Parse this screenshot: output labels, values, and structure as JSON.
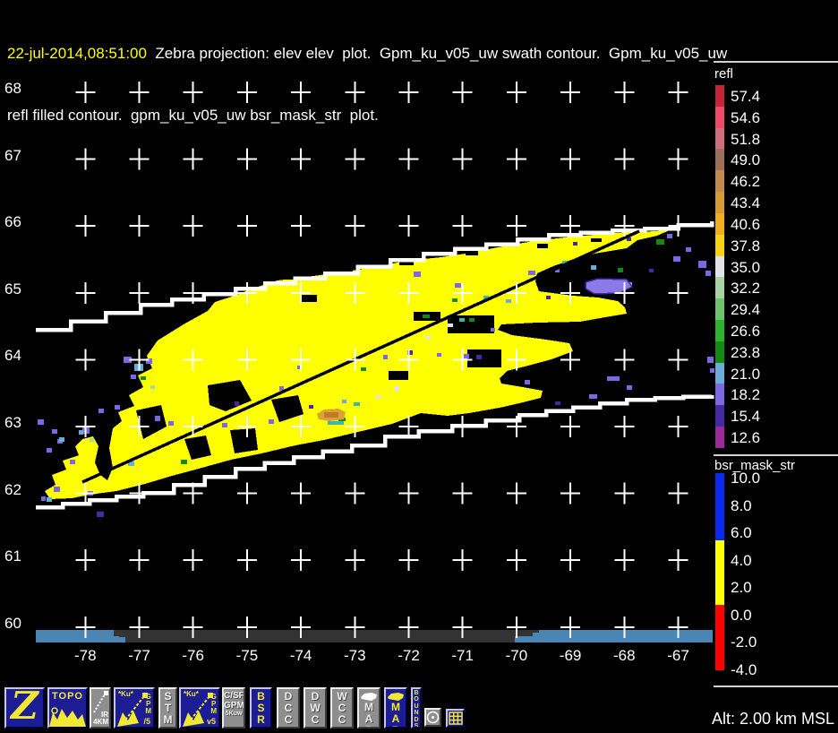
{
  "header": {
    "timestamp": "22-jul-2014,08:51:00",
    "title_line1": "Zebra projection: elev elev  plot.  Gpm_ku_v05_uw swath contour.  Gpm_ku_v05_uw",
    "title_line2": "refl filled contour.  gpm_ku_v05_uw bsr_mask_str  plot."
  },
  "map": {
    "lat_labels": [
      "68",
      "67",
      "66",
      "65",
      "64",
      "63",
      "62",
      "61",
      "60"
    ],
    "lon_labels": [
      "-78",
      "-77",
      "-76",
      "-75",
      "-74",
      "-73",
      "-72",
      "-71",
      "-70",
      "-69",
      "-68",
      "-67"
    ]
  },
  "legend_refl": {
    "title": "refl",
    "entries": [
      {
        "label": "57.4",
        "color": "#c32438"
      },
      {
        "label": "54.6",
        "color": "#ee4a68"
      },
      {
        "label": "51.8",
        "color": "#cd6f7a"
      },
      {
        "label": "49.0",
        "color": "#9e6f58"
      },
      {
        "label": "46.2",
        "color": "#c28a4c"
      },
      {
        "label": "43.4",
        "color": "#d89a35"
      },
      {
        "label": "40.6",
        "color": "#f0ae1e"
      },
      {
        "label": "37.8",
        "color": "#f6d411"
      },
      {
        "label": "35.0",
        "color": "#e2e3e8"
      },
      {
        "label": "32.2",
        "color": "#a9d3a2"
      },
      {
        "label": "29.4",
        "color": "#6dc46d"
      },
      {
        "label": "26.6",
        "color": "#2db22d"
      },
      {
        "label": "23.8",
        "color": "#138a13"
      },
      {
        "label": "21.0",
        "color": "#6badd6"
      },
      {
        "label": "18.2",
        "color": "#7b68e2"
      },
      {
        "label": "15.4",
        "color": "#4429a0"
      },
      {
        "label": "12.6",
        "color": "#9a2b98"
      }
    ]
  },
  "legend_bsr": {
    "title": "bsr_mask_str",
    "labels": [
      "10.0",
      "8.0",
      "6.0",
      "4.0",
      "2.0",
      "0.0",
      "-2.0",
      "-4.0"
    ],
    "segments": [
      {
        "color": "#0a28f0",
        "from": "10.0",
        "to": "6.0"
      },
      {
        "color": "#ffff00",
        "from": "6.0",
        "to": "0.0"
      },
      {
        "color": "#ff0000",
        "from": "0.0",
        "to": "-4.0"
      }
    ]
  },
  "status": {
    "altitude": "Alt: 2.00 km MSL"
  },
  "toolbar": {
    "buttons": [
      {
        "id": "zebra-logo",
        "label": "Z",
        "style": "navy"
      },
      {
        "id": "topo",
        "label": "TOPO",
        "style": "navy"
      },
      {
        "id": "ir-4km",
        "label": "IR 4KM",
        "style": "gray"
      },
      {
        "id": "gpm-ku-5",
        "corner": "*Ku*",
        "side": "GPM",
        "suffix": "/5",
        "style": "navy"
      },
      {
        "id": "stm",
        "label": "STM",
        "style": "gray"
      },
      {
        "id": "gpm-ku-v5",
        "corner": "*Ku*",
        "side": "GPM",
        "suffix": "v5",
        "style": "navy"
      },
      {
        "id": "csf-gpm",
        "lines": [
          "C/SF",
          "GPM",
          "5Kuw"
        ],
        "style": "gray"
      },
      {
        "id": "bsr",
        "label": "BSR",
        "style": "navy"
      },
      {
        "id": "dcc",
        "label": "DCC",
        "style": "gray"
      },
      {
        "id": "dwc",
        "label": "DWC",
        "style": "gray"
      },
      {
        "id": "wcc",
        "label": "WCC",
        "style": "gray"
      },
      {
        "id": "map-overlay",
        "label": "MAP",
        "style": "gray"
      },
      {
        "id": "map-active",
        "label": "MAP",
        "style": "navy"
      },
      {
        "id": "bounds",
        "label": "BOUNDS",
        "style": "navy"
      },
      {
        "id": "origin",
        "icon": "crosshair",
        "style": "gray"
      },
      {
        "id": "grid",
        "icon": "grid",
        "style": "navy"
      }
    ]
  },
  "colors": {
    "swath_fill": "#ffff00",
    "swath_contour": "#ffffff",
    "track_line": "#000000",
    "ocean_band": "#4a86b4",
    "land_band": "#333333",
    "accent_yellow": "#f0e832",
    "button_navy": "#1c1c94",
    "button_gray": "#8e8e8e"
  }
}
